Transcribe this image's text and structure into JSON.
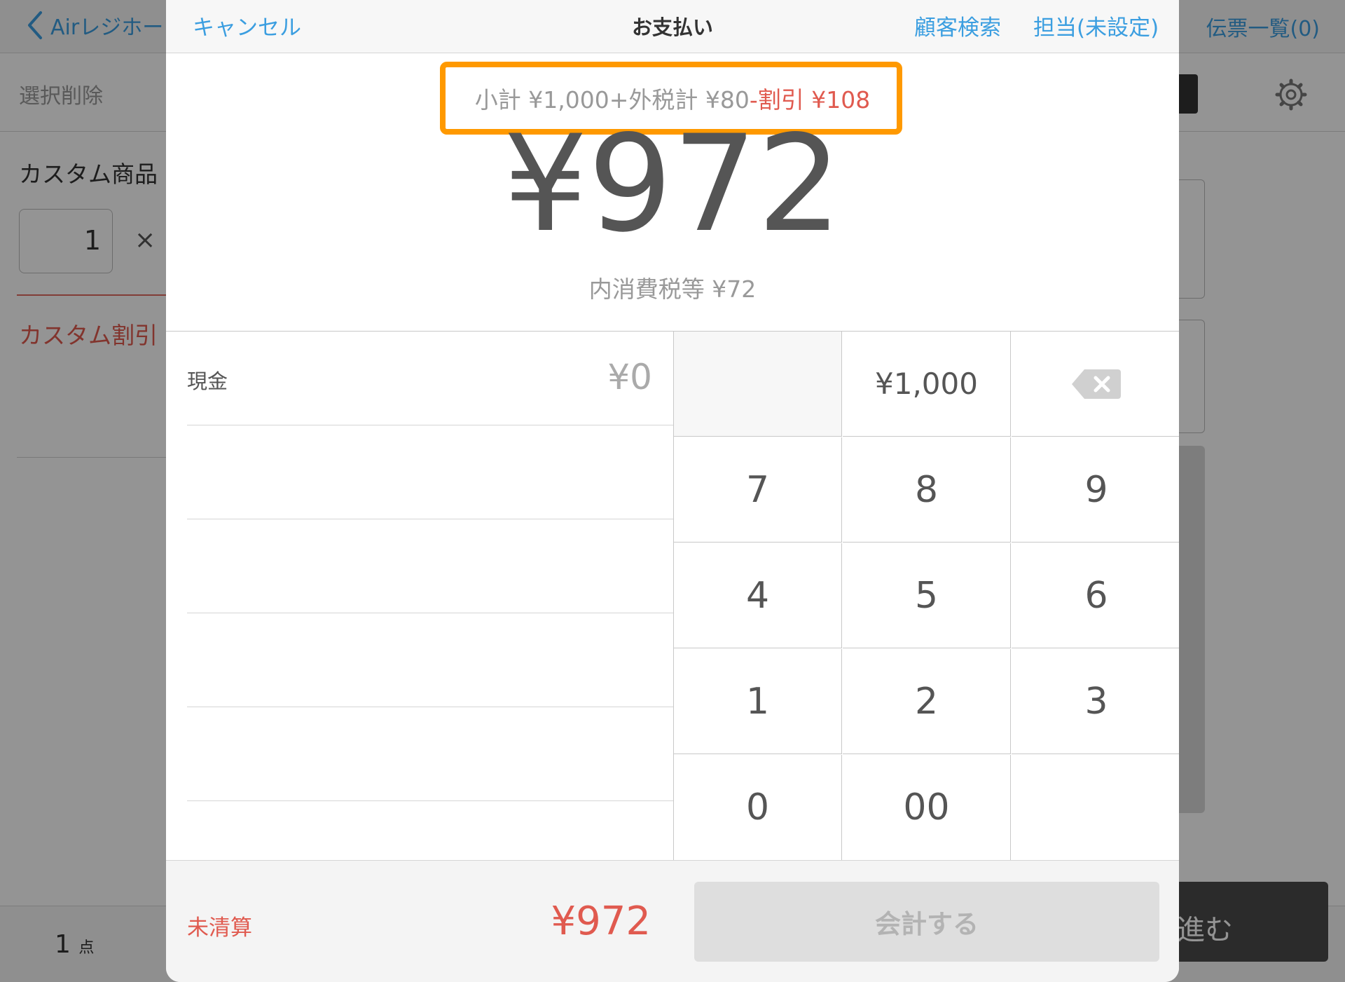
{
  "background": {
    "back_label": "Airレジホー",
    "slips_label": "伝票一覧(0)",
    "delete_label": "選択削除",
    "item_name": "カスタム商品",
    "quantity": "1",
    "times_symbol": "×",
    "discount_label": "カスタム割引",
    "count_value": "1",
    "count_unit": "点",
    "next_label": "進む"
  },
  "header": {
    "cancel_label": "キャンセル",
    "title": "お支払い",
    "customer_search_label": "顧客検索",
    "staff_label": "担当(未設定)"
  },
  "summary": {
    "text": "小計 ¥1,000+外税計 ¥80",
    "discount_text": "-割引 ¥108"
  },
  "total": "¥972",
  "tax_included": "内消費税等 ¥72",
  "payments": [
    {
      "label": "現金",
      "amount": "¥0"
    }
  ],
  "keypad": {
    "preset": "¥1,000",
    "keys": [
      "7",
      "8",
      "9",
      "4",
      "5",
      "6",
      "1",
      "2",
      "3",
      "0",
      "00"
    ]
  },
  "footer": {
    "status_label": "未清算",
    "remaining_amount": "¥972",
    "checkout_label": "会計する"
  },
  "colors": {
    "accent_blue": "#3b9ee0",
    "alert_red": "#e05a4f",
    "highlight_orange": "#ff9900"
  }
}
